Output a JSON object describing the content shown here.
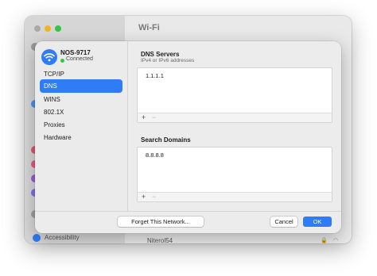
{
  "background": {
    "title": "Wi-Fi",
    "accessibility_label": "Accessibility",
    "network_row": "Niterol54"
  },
  "sheet": {
    "network": {
      "name": "NOS-9717",
      "status": "Connected"
    },
    "sidebar": [
      {
        "label": "TCP/IP"
      },
      {
        "label": "DNS",
        "active": true
      },
      {
        "label": "WINS"
      },
      {
        "label": "802.1X"
      },
      {
        "label": "Proxies"
      },
      {
        "label": "Hardware"
      }
    ],
    "dns_servers": {
      "title": "DNS Servers",
      "subtitle": "IPv4 or IPv6 addresses",
      "entries": [
        "1.1.1.1"
      ],
      "add_label": "+",
      "remove_label": "−"
    },
    "search_domains": {
      "title": "Search Domains",
      "entries": [
        "8.8.8.8"
      ],
      "add_label": "+",
      "remove_label": "−"
    },
    "footer": {
      "forget_label": "Forget This Network...",
      "cancel_label": "Cancel",
      "ok_label": "OK"
    }
  },
  "colors": {
    "accent": "#2f7cf6",
    "connected": "#2ecc40"
  },
  "icons": [
    "wifi-icon",
    "lock-icon",
    "accessibility-icon"
  ]
}
